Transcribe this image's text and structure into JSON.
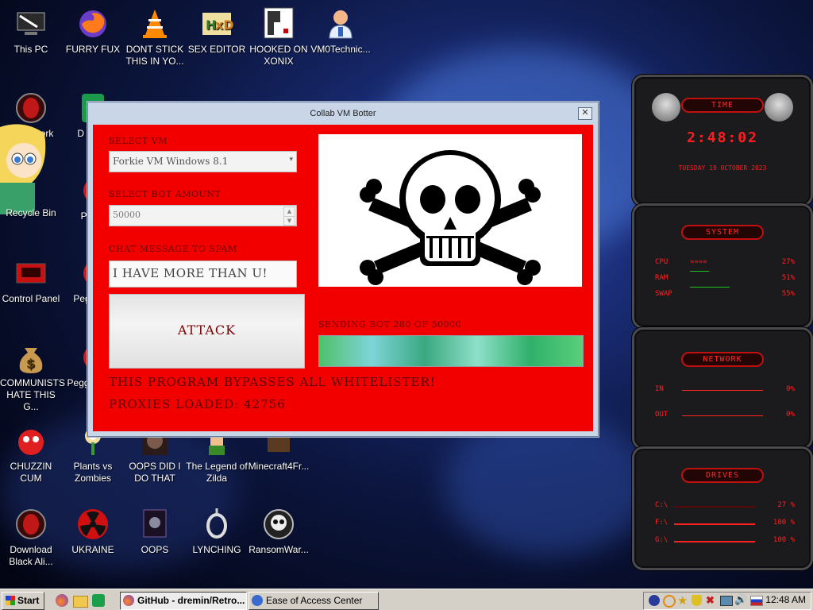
{
  "desktop_icons": [
    {
      "label": "This PC",
      "icon": "computer-icon"
    },
    {
      "label": "FURRY FUX",
      "icon": "firefox-icon"
    },
    {
      "label": "DONT STICK THIS IN YO...",
      "icon": "vlc-icon"
    },
    {
      "label": "SEX EDITOR",
      "icon": "hxd-icon"
    },
    {
      "label": "HOOKED ON XONIX",
      "icon": "xonix-icon"
    },
    {
      "label": "VM0Technic...",
      "icon": "technician-icon"
    },
    {
      "label": "Recycle Bin",
      "icon": "recycle-bin-icon"
    },
    {
      "label": "Peggl",
      "icon": "peggle-icon"
    },
    {
      "label": "Control Panel",
      "icon": "control-panel-icon"
    },
    {
      "label": "Peggl De",
      "icon": "peggle-icon"
    },
    {
      "label": "COMMUNISTS HATE THIS G...",
      "icon": "money-bag-icon"
    },
    {
      "label": "Peggl of Wa",
      "icon": "peggle-icon"
    },
    {
      "label": "CHUZZIN CUM",
      "icon": "chuzzle-icon"
    },
    {
      "label": "Plants vs Zombies",
      "icon": "flower-icon"
    },
    {
      "label": "OOPS DID I DO THAT",
      "icon": "oops-icon"
    },
    {
      "label": "The Legend of Zilda",
      "icon": "zelda-icon"
    },
    {
      "label": "Minecraft4Fr...",
      "icon": "minecraft-icon"
    },
    {
      "label": "Download Black Ali...",
      "icon": "alien-icon"
    },
    {
      "label": "UKRAINE",
      "icon": "radiation-icon"
    },
    {
      "label": "OOPS",
      "icon": "dark-app-icon"
    },
    {
      "label": "LYNCHING",
      "icon": "rope-icon"
    },
    {
      "label": "RansomWar...",
      "icon": "skull-icon"
    },
    {
      "label": "D DUM",
      "icon": "app-icon"
    },
    {
      "label": "ork",
      "icon": "alien-icon"
    }
  ],
  "dialog": {
    "title": "Collab VM Botter",
    "select_vm_label": "SELECT VM",
    "select_vm_value": "Forkie VM Windows 8.1",
    "bot_amount_label": "SELECT BOT AMOUNT",
    "bot_amount_value": "50000",
    "chat_label": "CHAT MESSAGE TO SPAM",
    "chat_value": "I HAVE MORE THAN U!",
    "attack_button": "ATTACK",
    "sending_status": "SENDING BOT 280 OF 50000",
    "progress": 1.0,
    "bypass_text": "THIS PROGRAM BYPASSES ALL WHITELISTER!",
    "proxies_text": "PROXIES LOADED: 42756",
    "image_icon": "skull-crossbones-icon"
  },
  "gadget": {
    "time": {
      "title": "TIME",
      "clock": "2:48:02",
      "date": "TUESDAY 19 OCTOBER 2023"
    },
    "system": {
      "title": "SYSTEM",
      "rows": [
        {
          "label": "CPU",
          "value": "27%",
          "level": 0.27
        },
        {
          "label": "RAM",
          "value": "51%",
          "level": 0.51
        },
        {
          "label": "SWAP",
          "value": "55%",
          "level": 0.55
        }
      ]
    },
    "network": {
      "title": "NETWORK",
      "rows": [
        {
          "label": "IN",
          "value": "0%"
        },
        {
          "label": "OUT",
          "value": "0%"
        }
      ]
    },
    "drives": {
      "title": "DRIVES",
      "rows": [
        {
          "label": "C:\\",
          "value": "27 %"
        },
        {
          "label": "F:\\",
          "value": "100 %"
        },
        {
          "label": "G:\\",
          "value": "100 %"
        }
      ]
    }
  },
  "taskbar": {
    "start_label": "Start",
    "tasks": [
      {
        "label": "GitHub - dremin/Retro...",
        "icon": "firefox-icon",
        "active": true
      },
      {
        "label": "Ease of Access Center",
        "icon": "ease-of-access-icon",
        "active": false
      }
    ],
    "clock": "12:48 AM"
  },
  "colors": {
    "dialog_red": "#f20000",
    "label_dark_red": "#6a0000",
    "widget_red": "#ff2020"
  }
}
